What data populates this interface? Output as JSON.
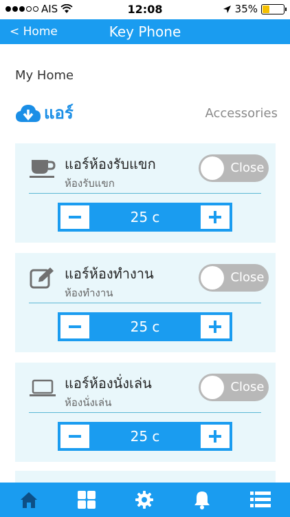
{
  "status_bar": {
    "carrier": "AIS",
    "time": "12:08",
    "battery": "35%",
    "battery_level": 0.35,
    "signal_bars": 3
  },
  "nav": {
    "back_label": "< Home",
    "title": "Key Phone"
  },
  "page": {
    "home_label": "My Home",
    "section_title": "แอร์",
    "accessories_label": "Accessories"
  },
  "devices": [
    {
      "title": "แอร์ห้องรับแขก",
      "subtitle": "ห้องรับแขก",
      "toggle_label": "Close",
      "value": "25 c",
      "icon": "coffee-cup-icon"
    },
    {
      "title": "แอร์ห้องทำงาน",
      "subtitle": "ห้องทำงาน",
      "toggle_label": "Close",
      "value": "25 c",
      "icon": "edit-icon"
    },
    {
      "title": "แอร์ห้องนั่งเล่น",
      "subtitle": "ห้องนั่งเล่น",
      "toggle_label": "Close",
      "value": "25 c",
      "icon": "laptop-icon"
    }
  ],
  "tabs": [
    "home-icon",
    "grid-icon",
    "gear-icon",
    "bell-icon",
    "list-icon"
  ],
  "colors": {
    "accent": "#1a9cf0",
    "card_bg": "#e9f7fb",
    "toggle_off": "#b8b8b8",
    "tab_active": "#0d4f86"
  }
}
